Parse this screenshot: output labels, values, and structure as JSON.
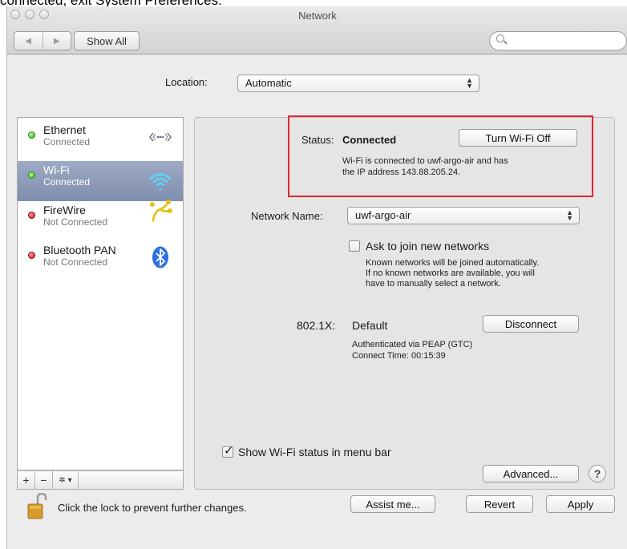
{
  "caption": "connected, exit System Preferences.",
  "window": {
    "title": "Network"
  },
  "toolbar": {
    "back_icon": "◀",
    "forward_icon": "▶",
    "show_all_label": "Show All",
    "search_placeholder": ""
  },
  "location": {
    "label": "Location:",
    "value": "Automatic"
  },
  "services": [
    {
      "name": "Ethernet",
      "status": "Connected",
      "indicator": "green",
      "icon": "ethernet-icon",
      "selected": false
    },
    {
      "name": "Wi-Fi",
      "status": "Connected",
      "indicator": "green",
      "icon": "wifi-icon",
      "selected": true
    },
    {
      "name": "FireWire",
      "status": "Not Connected",
      "indicator": "red",
      "icon": "firewire-icon",
      "selected": false
    },
    {
      "name": "Bluetooth PAN",
      "status": "Not Connected",
      "indicator": "red",
      "icon": "bluetooth-icon",
      "selected": false
    }
  ],
  "list_footer": {
    "add": "+",
    "remove": "−",
    "gear": "✲ ▾"
  },
  "detail": {
    "status_label": "Status:",
    "status_value": "Connected",
    "turn_off_label": "Turn Wi-Fi Off",
    "status_desc_1": "Wi-Fi is connected to uwf-argo-air and has",
    "status_desc_2": "the IP address 143.88.205.24.",
    "network_name_label": "Network Name:",
    "network_name_value": "uwf-argo-air",
    "ask_join_label": "Ask to join new networks",
    "ask_join_checked": false,
    "ask_desc_1": "Known networks will be joined automatically.",
    "ask_desc_2": "If no known networks are available, you will",
    "ask_desc_3": "have to manually select a network.",
    "dot1x_label": "802.1X:",
    "dot1x_value": "Default",
    "disconnect_label": "Disconnect",
    "auth_line": "Authenticated via PEAP (GTC)",
    "connect_time_line": "Connect Time: 00:15:39",
    "show_status_label": "Show Wi-Fi status in menu bar",
    "show_status_checked": true,
    "advanced_label": "Advanced...",
    "help_label": "?"
  },
  "bottom": {
    "lock_text": "Click the lock to prevent further changes.",
    "assist_label": "Assist me...",
    "revert_label": "Revert",
    "apply_label": "Apply"
  },
  "colors": {
    "highlight": "#e0262d",
    "selection": "#8a98b8"
  }
}
